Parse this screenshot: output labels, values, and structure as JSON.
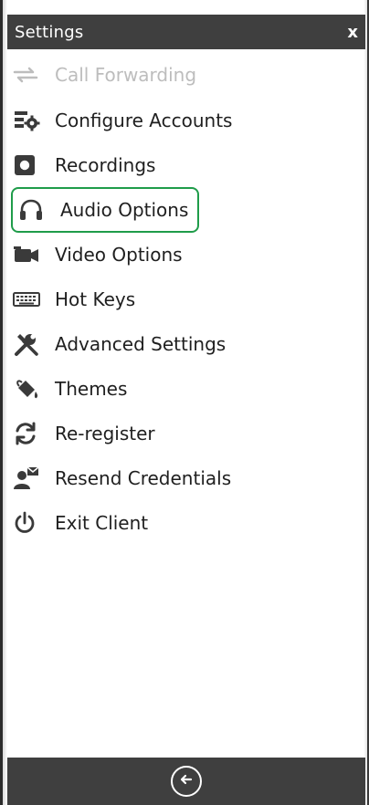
{
  "window": {
    "title": "Settings",
    "close_label": "x"
  },
  "menu": {
    "items": [
      {
        "label": "Call Forwarding",
        "icon": "call-forwarding-icon",
        "disabled": true,
        "selected": false
      },
      {
        "label": "Configure Accounts",
        "icon": "configure-accounts-icon",
        "disabled": false,
        "selected": false
      },
      {
        "label": "Recordings",
        "icon": "recordings-icon",
        "disabled": false,
        "selected": false
      },
      {
        "label": "Audio Options",
        "icon": "headphones-icon",
        "disabled": false,
        "selected": true
      },
      {
        "label": "Video Options",
        "icon": "video-camera-icon",
        "disabled": false,
        "selected": false
      },
      {
        "label": "Hot Keys",
        "icon": "keyboard-icon",
        "disabled": false,
        "selected": false
      },
      {
        "label": "Advanced Settings",
        "icon": "tools-icon",
        "disabled": false,
        "selected": false
      },
      {
        "label": "Themes",
        "icon": "paint-bucket-icon",
        "disabled": false,
        "selected": false
      },
      {
        "label": "Re-register",
        "icon": "refresh-icon",
        "disabled": false,
        "selected": false
      },
      {
        "label": "Resend Credentials",
        "icon": "user-mail-icon",
        "disabled": false,
        "selected": false
      },
      {
        "label": "Exit Client",
        "icon": "power-icon",
        "disabled": false,
        "selected": false
      }
    ]
  },
  "colors": {
    "titlebar": "#3f3f3f",
    "selected_border": "#1f9c4a",
    "disabled_text": "#bdbdbd",
    "text": "#1f1f1f"
  },
  "footer": {
    "back_icon": "back-arrow-icon"
  }
}
